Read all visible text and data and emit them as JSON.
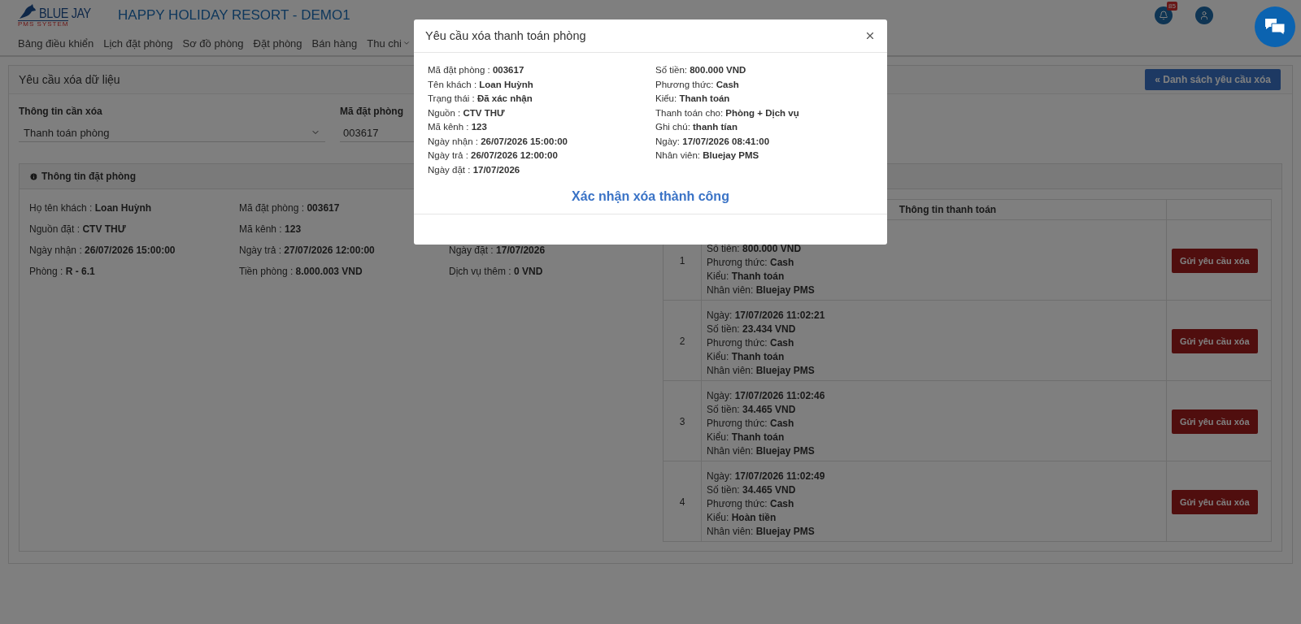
{
  "header": {
    "logo_text": "BLUE JAY",
    "logo_sub": "PMS SYSTEM",
    "title": "HAPPY HOLIDAY RESORT - DEMO1",
    "notification_count": "85"
  },
  "nav": [
    {
      "label": "Bảng điều khiển",
      "has_caret": false
    },
    {
      "label": "Lịch đặt phòng",
      "has_caret": false
    },
    {
      "label": "Sơ đồ phòng",
      "has_caret": false
    },
    {
      "label": "Đặt phòng",
      "has_caret": false
    },
    {
      "label": "Bán hàng",
      "has_caret": false
    },
    {
      "label": "Thu chi",
      "has_caret": true
    }
  ],
  "page": {
    "title": "Yêu cầu xóa dữ liệu",
    "back_button": "« Danh sách yêu cầu xóa"
  },
  "form": [
    {
      "kind": "select",
      "label": "Thông tin cần xóa",
      "value": "Thanh toán phòng"
    },
    {
      "kind": "input",
      "label": "Mã đặt phòng",
      "value": "003617"
    }
  ],
  "booking_panel": {
    "title": "Thông tin đặt phòng",
    "rows": [
      [
        "Họ tên khách : **Loan Huỳnh**",
        "Mã đặt phòng : **003617**"
      ],
      [
        "Nguồn đặt : **CTV THƯ**",
        "Mã kênh : **123**"
      ],
      [
        "Ngày nhận : **26/07/2026 15:00:00**",
        "Ngày trả : **27/07/2026 12:00:00**",
        "Ngày đặt : **17/07/2026**"
      ],
      [
        "Phòng : **R - 6.1**",
        "Tiền phòng : **8.000.003 VND**",
        "Dịch vụ thêm : **0 VND**"
      ]
    ]
  },
  "payments": {
    "column_2": "Thông tin thanh toán",
    "rows": [
      {
        "index": "1",
        "button": "Gửi yêu cầu xóa",
        "lines": [
          "Số tiền: **800.000 VND**",
          "Phương thức: **Cash**",
          "Kiểu: **Thanh toán**",
          "Nhân viên: **Bluejay PMS**"
        ]
      },
      {
        "index": "2",
        "button": "Gửi yêu cầu xóa",
        "lines": [
          "Ngày: **17/07/2026 11:02:21**",
          "Số tiền: **23.434 VND**",
          "Phương thức: **Cash**",
          "Kiểu: **Thanh toán**",
          "Nhân viên: **Bluejay PMS**"
        ]
      },
      {
        "index": "3",
        "button": "Gửi yêu cầu xóa",
        "lines": [
          "Ngày: **17/07/2026 11:02:46**",
          "Số tiền: **34.465 VND**",
          "Phương thức: **Cash**",
          "Kiểu: **Thanh toán**",
          "Nhân viên: **Bluejay PMS**"
        ]
      },
      {
        "index": "4",
        "button": "Gửi yêu cầu xóa",
        "lines": [
          "Ngày: **17/07/2026 11:02:49**",
          "Số tiền: **34.465 VND**",
          "Phương thức: **Cash**",
          "Kiểu: **Hoàn tiền**",
          "Nhân viên: **Bluejay PMS**"
        ]
      }
    ]
  },
  "modal": {
    "title": "Yêu cầu xóa thanh toán phòng",
    "left": [
      "Mã đặt phòng : **003617**",
      "Tên khách : **Loan Huỳnh**",
      "Trạng thái : **Đã xác nhận**",
      "Nguồn : **CTV THƯ**",
      "Mã kênh : **123**",
      "Ngày nhận : **26/07/2026 15:00:00**",
      "Ngày trả : **26/07/2026 12:00:00**",
      "Ngày đặt : **17/07/2026**"
    ],
    "right": [
      "Số tiền: **800.000 VND**",
      "Phương thức: **Cash**",
      "Kiểu: **Thanh toán**",
      "Thanh toán cho: **Phòng + Dịch vụ**",
      "Ghi chú: **thanh tían**",
      "Ngày: **17/07/2026 08:41:00**",
      "Nhân viên: **Bluejay PMS**"
    ],
    "confirm": "Xác nhận xóa thành công"
  }
}
